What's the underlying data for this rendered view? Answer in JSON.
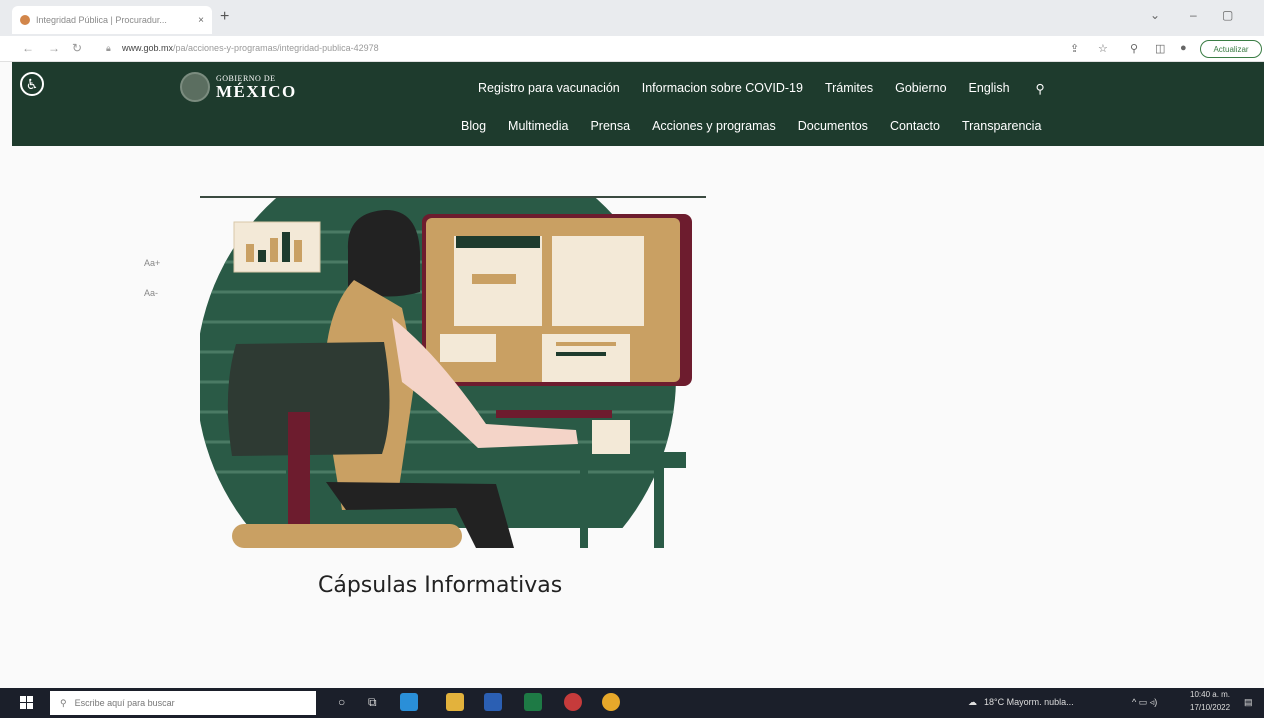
{
  "browser": {
    "tab_title": "Integridad Pública | Procuradur...",
    "tab_close": "×",
    "new_tab": "+",
    "url_domain": "www.gob.mx",
    "url_path": "/pa/acciones-y-programas/integridad-publica-42978",
    "update_button": "Actualizar"
  },
  "header": {
    "logo_line1": "GOBIERNO DE",
    "logo_line2": "MÉXICO",
    "nav_top": [
      "Registro para vacunación",
      "Informacion sobre COVID-19",
      "Trámites",
      "Gobierno",
      "English"
    ],
    "nav_bottom": [
      "Blog",
      "Multimedia",
      "Prensa",
      "Acciones y programas",
      "Documentos",
      "Contacto",
      "Transparencia"
    ]
  },
  "page": {
    "font_increase": "Aa+",
    "font_decrease": "Aa-",
    "caption": "Cápsulas Informativas"
  },
  "taskbar": {
    "search_placeholder": "Escribe aquí para buscar",
    "weather": "18°C  Mayorm. nubla...",
    "time": "10:40 a. m.",
    "date": "17/10/2022"
  },
  "colors": {
    "gob_green": "#1e3b2d",
    "accent_gold": "#c9a063",
    "accent_maroon": "#6d1c2e"
  }
}
